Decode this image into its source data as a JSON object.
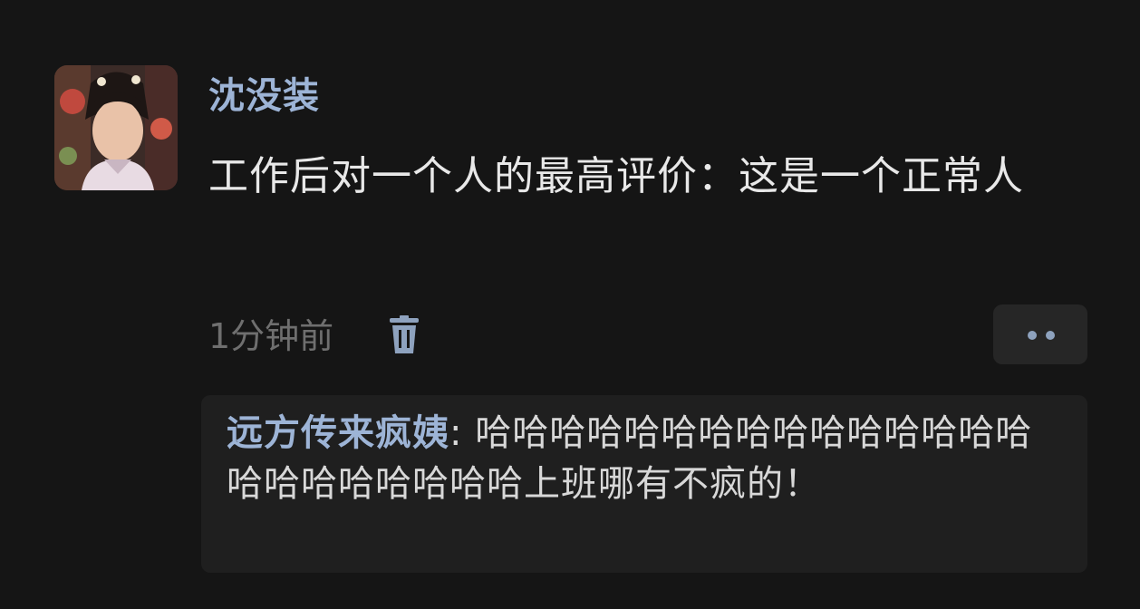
{
  "post": {
    "username": "沈没装",
    "content": "工作后对一个人的最高评价：这是一个正常人",
    "time": "1分钟前"
  },
  "actions": {
    "delete_icon": "trash-icon",
    "more_icon": "more-dots-icon"
  },
  "reply": {
    "author": "远方传来疯姨",
    "separator": ": ",
    "text": "哈哈哈哈哈哈哈哈哈哈哈哈哈哈哈哈哈哈哈哈哈哈哈上班哪有不疯的！"
  },
  "colors": {
    "background": "#151515",
    "username": "#9db4d6",
    "content": "#e8e8e8",
    "muted": "#6f6f6f",
    "reply_background": "#1f1f1f"
  }
}
